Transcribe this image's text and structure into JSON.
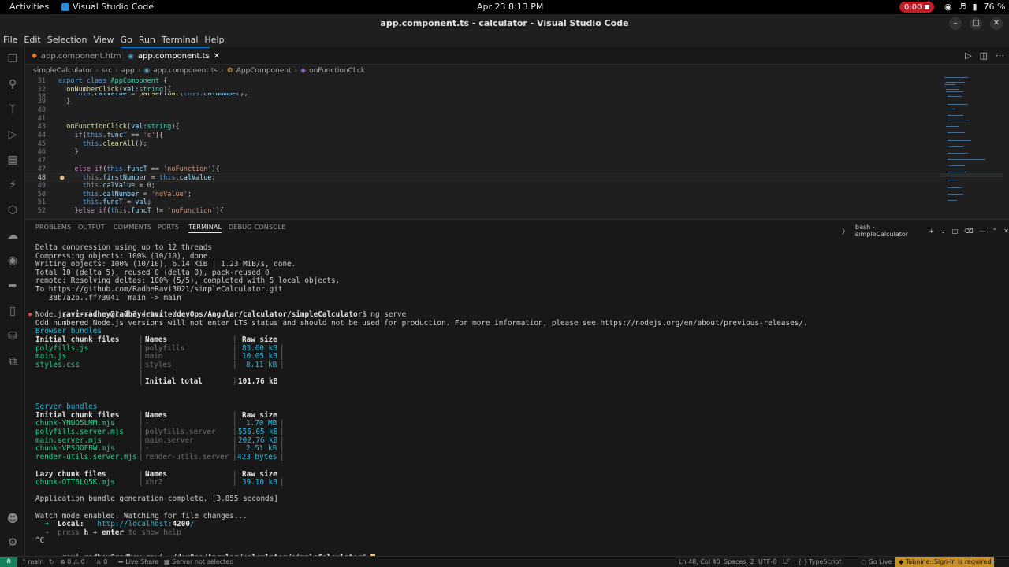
{
  "gnome": {
    "activities": "Activities",
    "app_name": "Visual Studio Code",
    "clock": "Apr 23   8:13 PM",
    "recording": "0:00",
    "battery": "76 %"
  },
  "window": {
    "title": "app.component.ts - calculator - Visual Studio Code"
  },
  "menu": [
    "File",
    "Edit",
    "Selection",
    "View",
    "Go",
    "Run",
    "Terminal",
    "Help"
  ],
  "tabs": [
    {
      "label": "app.component.html",
      "active": false
    },
    {
      "label": "app.component.ts",
      "active": true
    }
  ],
  "breadcrumb": [
    "simpleCalculator",
    "src",
    "app",
    "app.component.ts",
    "AppComponent",
    "onFunctionClick"
  ],
  "editor": {
    "lines": [
      {
        "n": "31",
        "text": "export class AppComponent {"
      },
      {
        "n": "32",
        "text": "  onNumberClick(val:string){"
      },
      {
        "n": "38",
        "text": "    this.calValue = parseFloat(this.calNumber);"
      },
      {
        "n": "39",
        "text": "  }"
      },
      {
        "n": "40",
        "text": ""
      },
      {
        "n": "41",
        "text": ""
      },
      {
        "n": "43",
        "text": "  onFunctionClick(val:string){"
      },
      {
        "n": "44",
        "text": "    if(this.funcT == 'c'){"
      },
      {
        "n": "45",
        "text": "      this.clearAll();"
      },
      {
        "n": "46",
        "text": "    }"
      },
      {
        "n": "47",
        "text": ""
      },
      {
        "n": "47",
        "text": "    else if(this.funcT == 'noFunction'){"
      },
      {
        "n": "48",
        "text": "      this.firstNumber = this.calValue;"
      },
      {
        "n": "49",
        "text": "      this.calValue = 0;"
      },
      {
        "n": "50",
        "text": "      this.calNumber = 'noValue';"
      },
      {
        "n": "51",
        "text": "      this.funcT = val;"
      },
      {
        "n": "52",
        "text": "    }else if(this.funcT != 'noFunction'){"
      }
    ]
  },
  "panel": {
    "tabs": [
      "PROBLEMS",
      "OUTPUT",
      "COMMENTS",
      "PORTS",
      "TERMINAL",
      "DEBUG CONSOLE"
    ],
    "active_tab": "TERMINAL",
    "terminal_name": "bash - simpleCalculator"
  },
  "terminal": {
    "lines": [
      "Delta compression using up to 12 threads",
      "Compressing objects: 100% (10/10), done.",
      "Writing objects: 100% (10/10), 6.14 KiB | 1.23 MiB/s, done.",
      "Total 10 (delta 5), reused 0 (delta 0), pack-reused 0",
      "remote: Resolving deltas: 100% (5/5), completed with 5 local objects.",
      "To https://github.com/RadheRavi3021/simpleCalculator.git",
      "   38b7a2b..ff73041  main -> main"
    ],
    "prompt_user": "ravi-radhey@radhey-ravi",
    "prompt_path": ":~/devOps/Angular/calculator/simpleCalculator",
    "prompt_sign": "$",
    "command": " ng serve",
    "node_version": "Node.js version v21.7.3 detected.",
    "node_warning": "Odd numbered Node.js versions will not enter LTS status and should not be used for production. For more information, please see https://nodejs.org/en/about/previous-releases/.",
    "browser_bundles_title": "Browser bundles",
    "browser_header": {
      "files": "Initial chunk files",
      "names": "Names",
      "size": "Raw size"
    },
    "browser_rows": [
      {
        "file": "polyfills.js",
        "name": "polyfills",
        "size": "83.60 kB"
      },
      {
        "file": "main.js",
        "name": "main",
        "size": "10.05 kB"
      },
      {
        "file": "styles.css",
        "name": "styles",
        "size": "8.11 kB"
      }
    ],
    "initial_total_label": "Initial total",
    "initial_total_value": "101.76 kB",
    "server_bundles_title": "Server bundles",
    "server_header": {
      "files": "Initial chunk files",
      "names": "Names",
      "size": "Raw size"
    },
    "server_rows": [
      {
        "file": "chunk-YNUO5LMM.mjs",
        "name": "-",
        "size": "1.70 MB"
      },
      {
        "file": "polyfills.server.mjs",
        "name": "polyfills.server",
        "size": "555.05 kB"
      },
      {
        "file": "main.server.mjs",
        "name": "main.server",
        "size": "202.76 kB"
      },
      {
        "file": "chunk-VPSODEBW.mjs",
        "name": "-",
        "size": "2.51 kB"
      },
      {
        "file": "render-utils.server.mjs",
        "name": "render-utils.server",
        "size": "423 bytes"
      }
    ],
    "lazy_header": {
      "files": "Lazy chunk files",
      "names": "Names",
      "size": "Raw size"
    },
    "lazy_rows": [
      {
        "file": "chunk-OTT6LQ5K.mjs",
        "name": "xhr2",
        "size": "39.10 kB"
      }
    ],
    "complete": "Application bundle generation complete. [3.855 seconds]",
    "watch": "Watch mode enabled. Watching for file changes...",
    "local_label": "Local:",
    "local_url": "http://localhost:",
    "local_port": "4200",
    "local_slash": "/",
    "help_pre": "press ",
    "help_key": "h + enter",
    "help_post": " to show help",
    "ctrl_c": "^C"
  },
  "statusbar": {
    "branch": "main",
    "sync": "↻",
    "errors": "⊗ 0 ⚠ 0",
    "ports": "0",
    "live_share": "Live Share",
    "server": "Server not selected",
    "position": "Ln 48, Col 40",
    "spaces": "Spaces: 2",
    "encoding": "UTF-8",
    "eol": "LF",
    "braces": "{ }",
    "language": "TypeScript",
    "go_live": "Go Live",
    "tabnine": "Tabnine: Sign-in is required"
  }
}
